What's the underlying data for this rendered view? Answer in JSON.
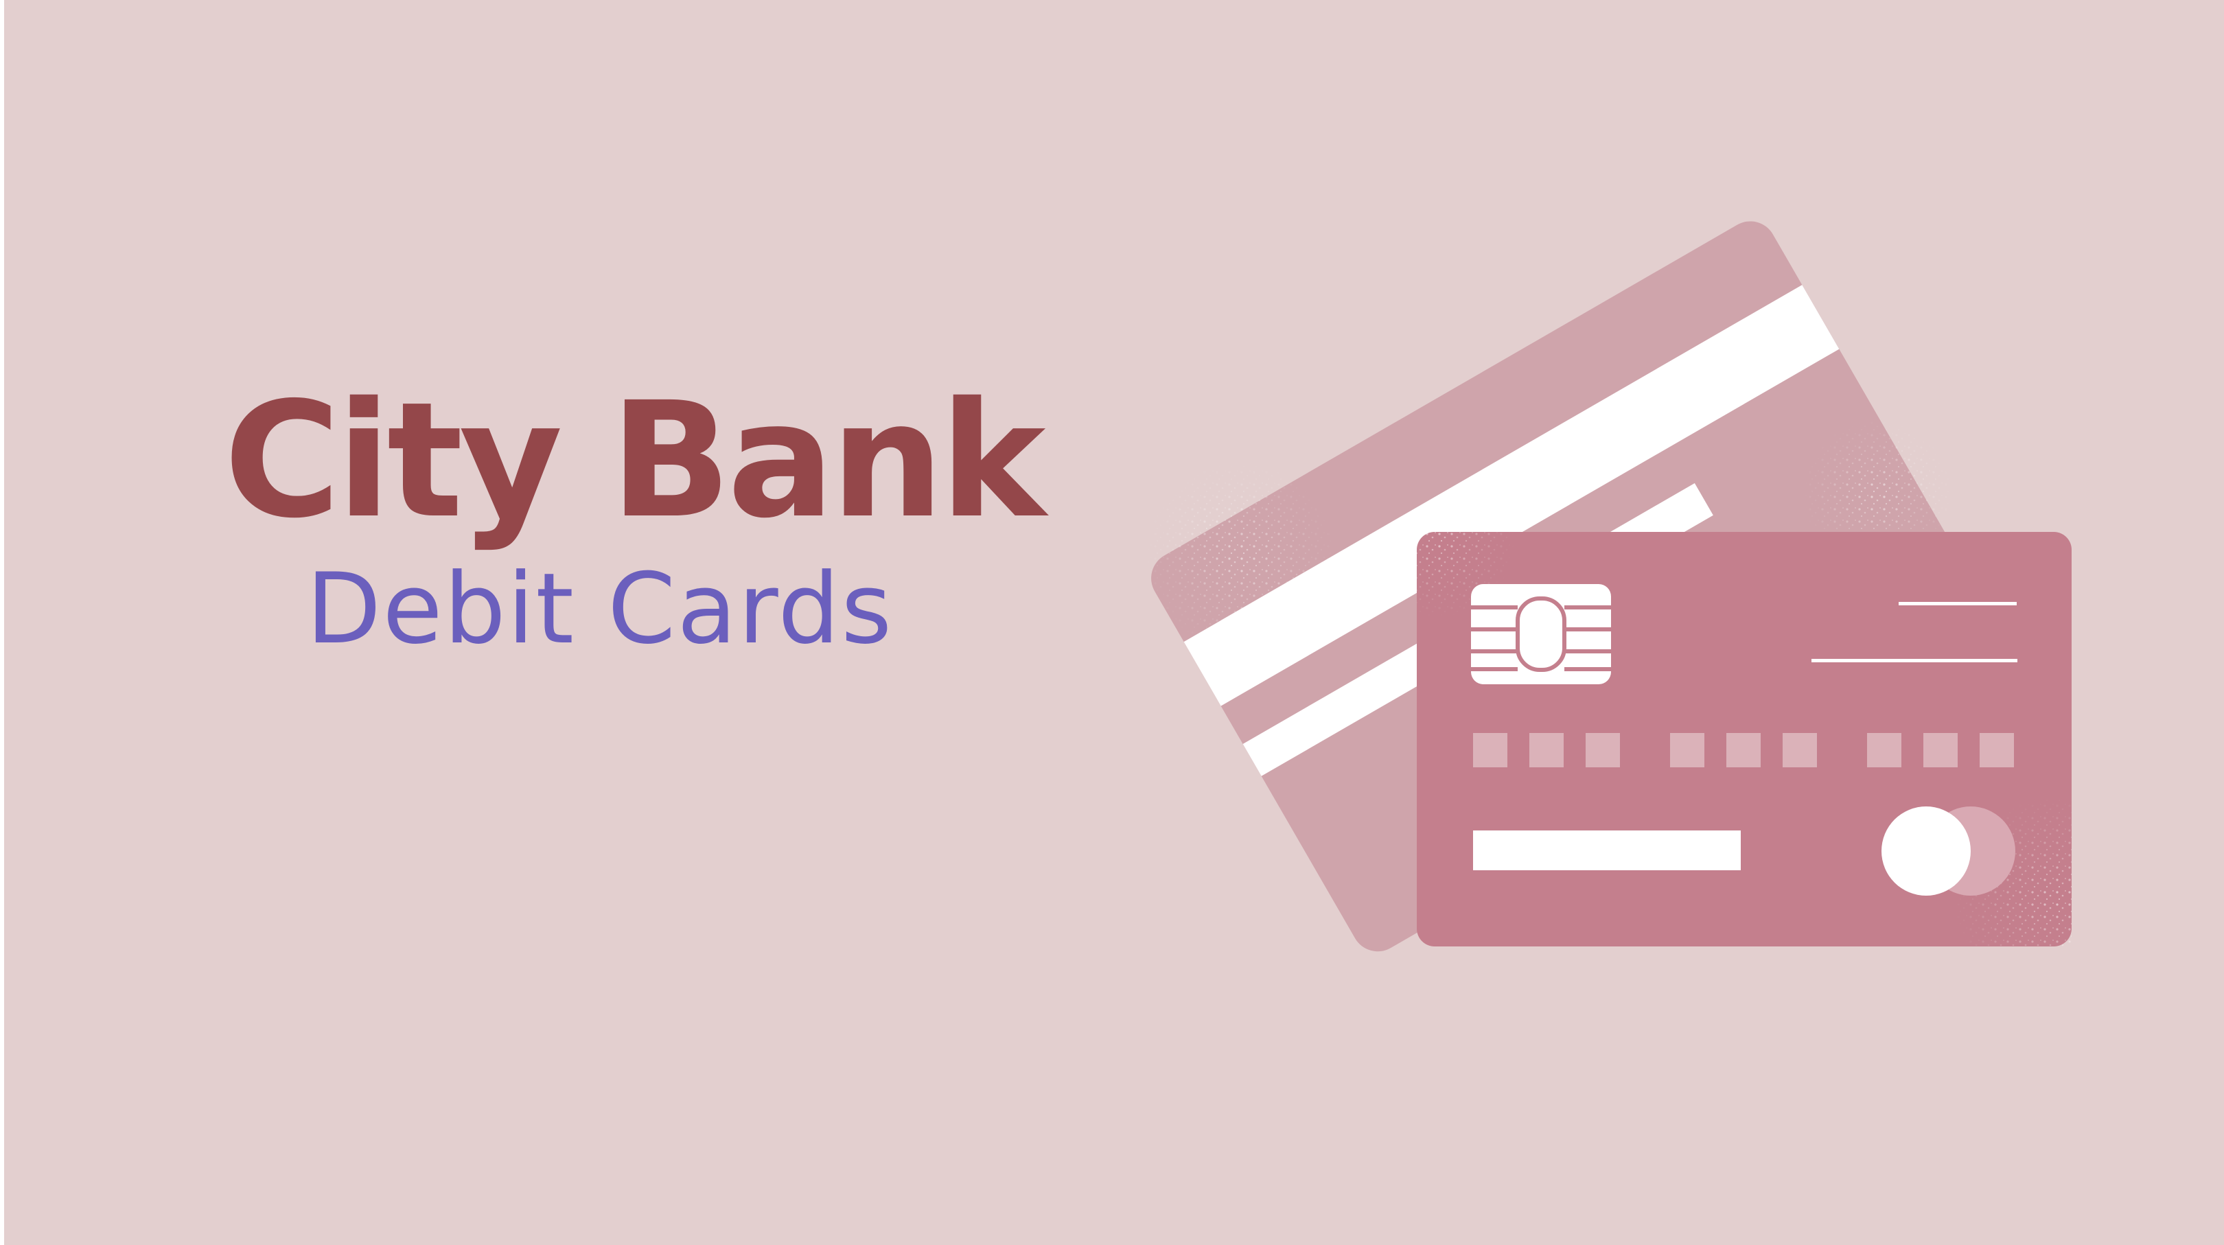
{
  "banner": {
    "title": "City Bank",
    "subtitle": "Debit Cards"
  },
  "colors": {
    "background": "#e3cfcf",
    "title": "#94474a",
    "subtitle": "#6b5fbd",
    "back_card": "#cfa4ab",
    "front_card": "#c47f8d",
    "card_detail": "#ffffff"
  },
  "illustration": {
    "icon": "credit-card-pair-icon"
  }
}
